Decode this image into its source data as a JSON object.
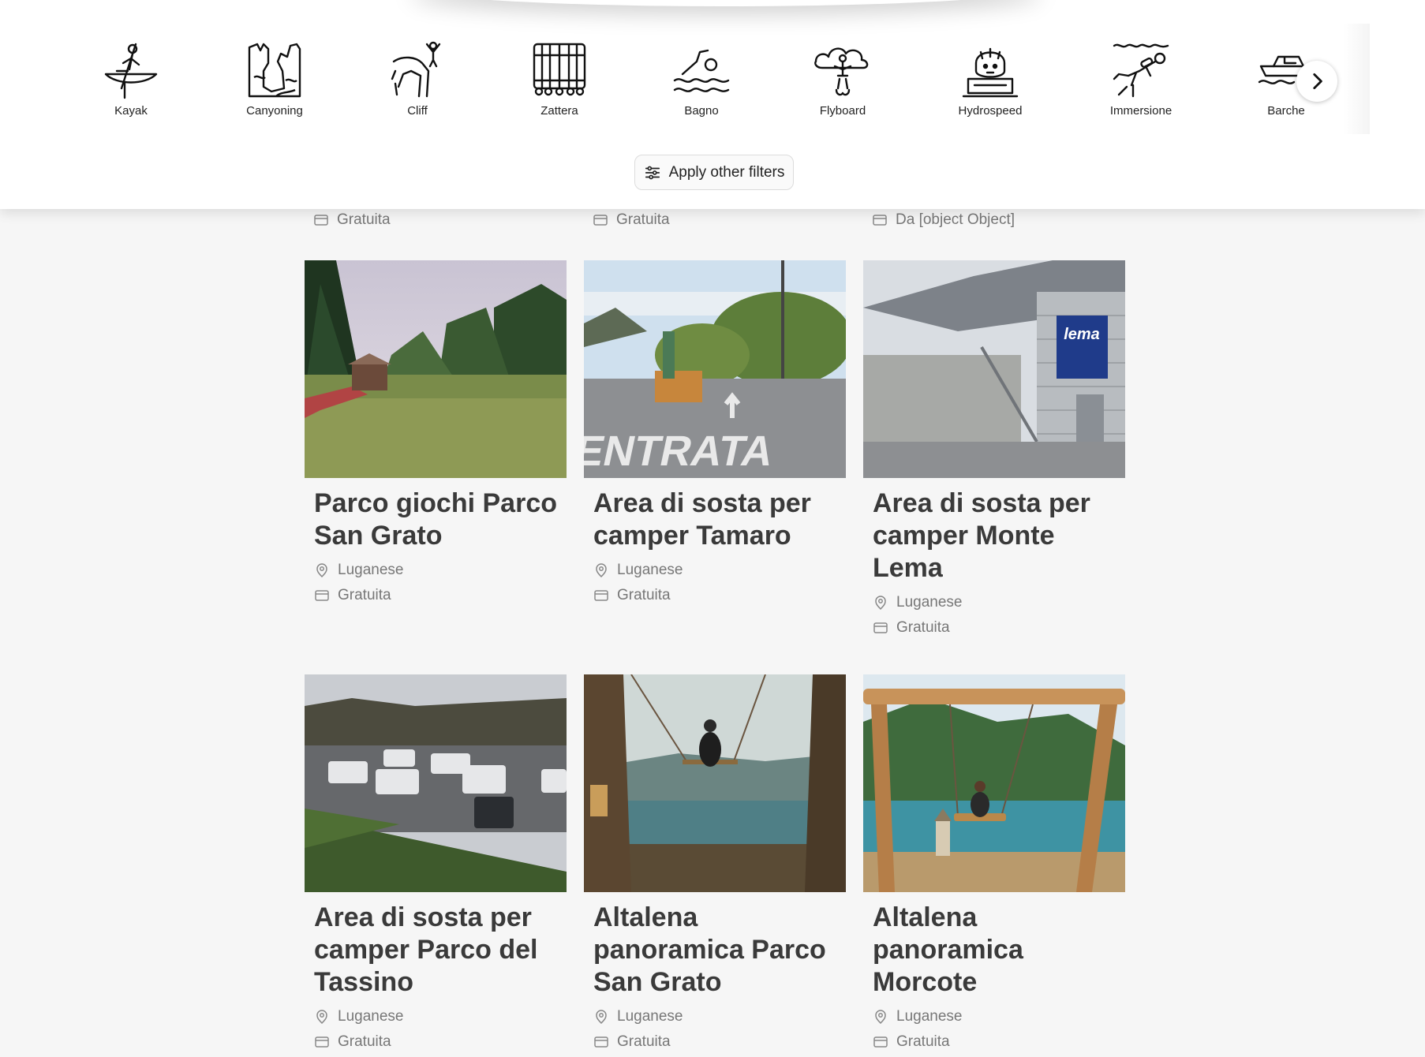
{
  "categories": [
    {
      "label": "Kayak",
      "icon": "kayak-icon"
    },
    {
      "label": "Canyoning",
      "icon": "canyoning-icon"
    },
    {
      "label": "Cliff",
      "icon": "cliff-icon"
    },
    {
      "label": "Zattera",
      "icon": "raft-icon"
    },
    {
      "label": "Bagno",
      "icon": "swimming-icon"
    },
    {
      "label": "Flyboard",
      "icon": "flyboard-icon"
    },
    {
      "label": "Hydrospeed",
      "icon": "hydrospeed-icon"
    },
    {
      "label": "Immersione",
      "icon": "diving-icon"
    },
    {
      "label": "Barche",
      "icon": "boat-icon"
    }
  ],
  "filters": {
    "apply_label": "Apply other filters",
    "icon": "sliders-icon"
  },
  "partial_row": [
    "Gratuita",
    "Gratuita",
    "Da [object Object]"
  ],
  "cards": [
    {
      "title": "Parco giochi Parco San Grato",
      "location": "Luganese",
      "price": "Gratuita",
      "image": "playground-photo"
    },
    {
      "title": "Area di sosta per camper Tamaro",
      "location": "Luganese",
      "price": "Gratuita",
      "image": "entrata-road-photo"
    },
    {
      "title": "Area di sosta per camper Monte Lema",
      "location": "Luganese",
      "price": "Gratuita",
      "image": "lema-cablecar-station-photo"
    },
    {
      "title": "Area di sosta per camper Parco del Tassino",
      "location": "Luganese",
      "price": "Gratuita",
      "image": "camper-parking-photo"
    },
    {
      "title": "Altalena panoramica Parco San Grato",
      "location": "Luganese",
      "price": "Gratuita",
      "image": "swing-lake-photo"
    },
    {
      "title": "Altalena panoramica Morcote",
      "location": "Luganese",
      "price": "Gratuita",
      "image": "morcote-swing-photo"
    }
  ]
}
